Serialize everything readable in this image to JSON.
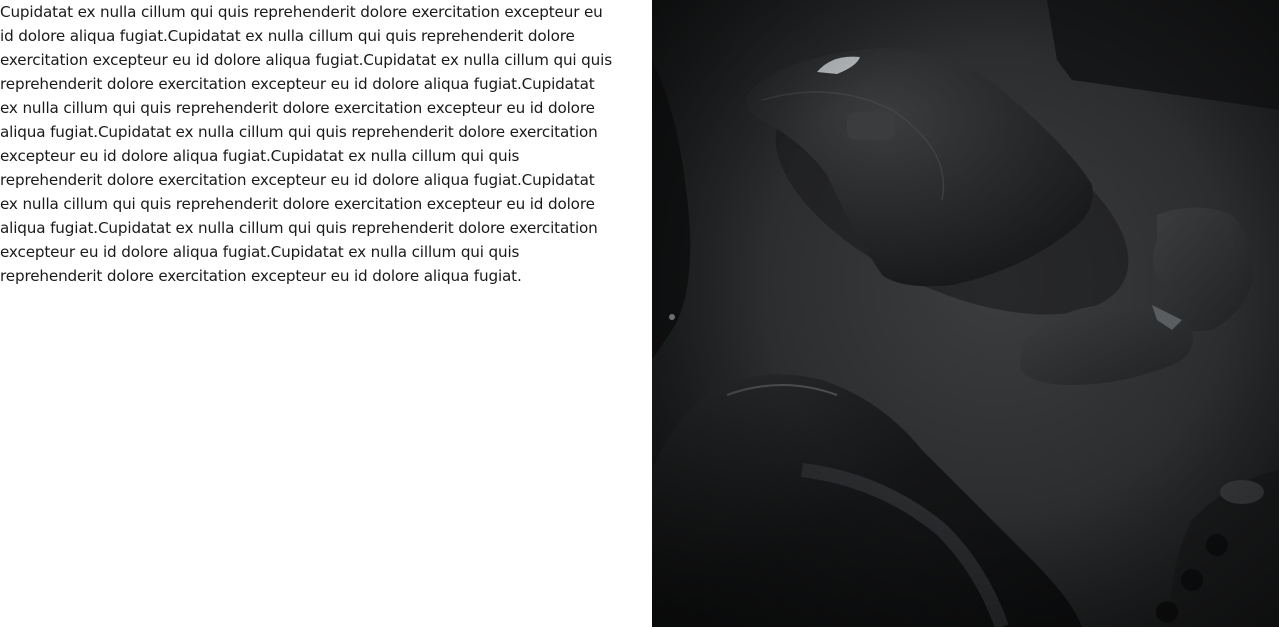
{
  "content": {
    "paragraph": "Cupidatat ex nulla cillum qui quis reprehenderit dolore exercitation excepteur eu id dolore aliqua fugiat.Cupidatat ex nulla cillum qui quis reprehenderit dolore exercitation excepteur eu id dolore aliqua fugiat.Cupidatat ex nulla cillum qui quis reprehenderit dolore exercitation excepteur eu id dolore aliqua fugiat.Cupidatat ex nulla cillum qui quis reprehenderit dolore exercitation excepteur eu id dolore aliqua fugiat.Cupidatat ex nulla cillum qui quis reprehenderit dolore exercitation excepteur eu id dolore aliqua fugiat.Cupidatat ex nulla cillum qui quis reprehenderit dolore exercitation excepteur eu id dolore aliqua fugiat.Cupidatat ex nulla cillum qui quis reprehenderit dolore exercitation excepteur eu id dolore aliqua fugiat.Cupidatat ex nulla cillum qui quis reprehenderit dolore exercitation excepteur eu id dolore aliqua fugiat.Cupidatat ex nulla cillum qui quis reprehenderit dolore exercitation excepteur eu id dolore aliqua fugiat."
  },
  "image": {
    "subject": "dark-photo-mouse-camera-lens",
    "palette": {
      "background": "#2c2e2f",
      "object": "#1d1f20",
      "highlight": "#5a5d5f"
    }
  }
}
